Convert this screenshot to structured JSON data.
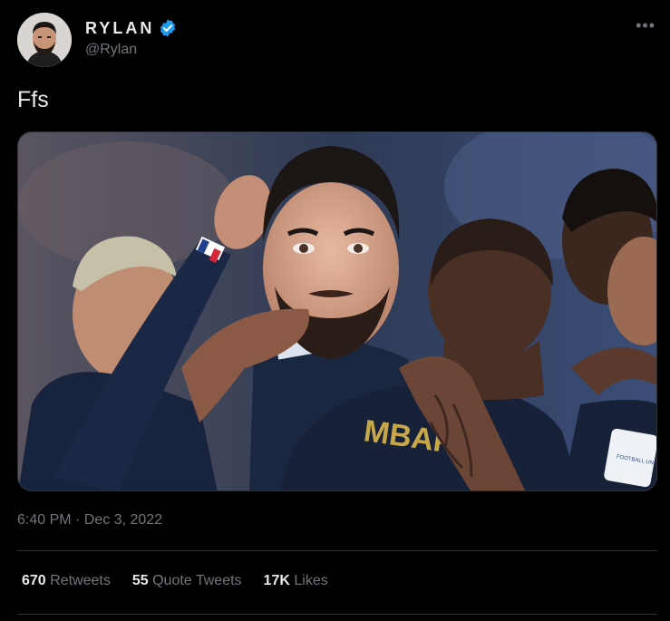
{
  "user": {
    "display_name": "RYLAN",
    "handle": "@Rylan",
    "verified_icon": "verified-badge-icon"
  },
  "menu_icon": "more-options-icon",
  "tweet": {
    "text": "Ffs",
    "media": {
      "jersey_text": "MBAPPE",
      "sleeve_patch": "FOOTBALL UNITES THE WORLD"
    },
    "timestamp": "6:40 PM · Dec 3, 2022"
  },
  "stats": {
    "retweets_count": "670",
    "retweets_label": "Retweets",
    "quotes_count": "55",
    "quotes_label": "Quote Tweets",
    "likes_count": "17K",
    "likes_label": "Likes"
  },
  "colors": {
    "background": "#000000",
    "text": "#e7e9ea",
    "muted": "#71767b",
    "verified": "#1d9bf0",
    "divider": "#2f3336",
    "jersey": "#1a2740",
    "jersey_lettering": "#c8a64a"
  }
}
